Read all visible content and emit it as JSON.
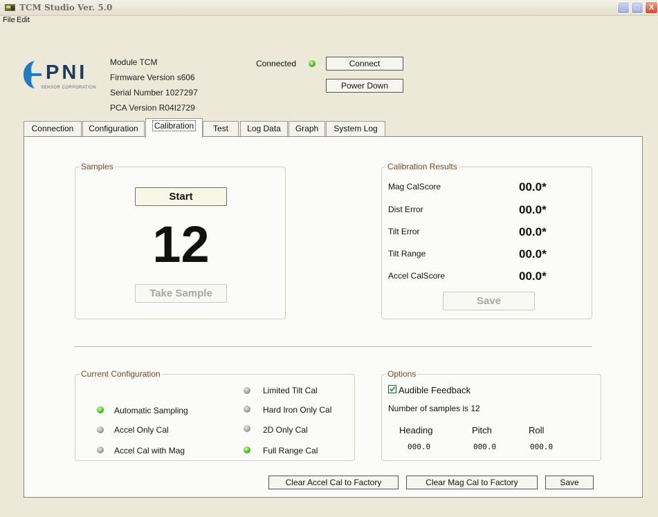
{
  "window": {
    "title": "TCM Studio Ver. 5.0"
  },
  "menu": [
    "File",
    "Edit"
  ],
  "header": {
    "logo_text": "PNI",
    "logo_subtext": "SENSOR CORPORATION",
    "module": "Module TCM",
    "firmware": "Firmware Version s606",
    "serial": "Serial Number 1027297",
    "pca": "PCA Version R04I2729",
    "connected_label": "Connected",
    "connect_label": "Connect",
    "power_down_label": "Power Down"
  },
  "tabs": [
    {
      "label": "Connection",
      "active": false
    },
    {
      "label": "Configuration",
      "active": false
    },
    {
      "label": "Calibration",
      "active": true
    },
    {
      "label": "Test",
      "active": false
    },
    {
      "label": "Log Data",
      "active": false
    },
    {
      "label": "Graph",
      "active": false
    },
    {
      "label": "System Log",
      "active": false
    }
  ],
  "samples": {
    "title": "Samples",
    "start_label": "Start",
    "count": "12",
    "take_sample_label": "Take Sample"
  },
  "results": {
    "title": "Calibration Results",
    "rows": [
      {
        "label": "Mag CalScore",
        "value": "00.0*"
      },
      {
        "label": "Dist Error",
        "value": "00.0*"
      },
      {
        "label": "Tilt Error",
        "value": "00.0*"
      },
      {
        "label": "Tilt Range",
        "value": "00.0*"
      },
      {
        "label": "Accel CalScore",
        "value": "00.0*"
      }
    ],
    "save_label": "Save"
  },
  "config": {
    "title": "Current Configuration",
    "items": [
      {
        "label": "Limited Tilt Cal",
        "status": "gray"
      },
      {
        "label": "Automatic Sampling",
        "status": "green"
      },
      {
        "label": "Hard Iron Only Cal",
        "status": "gray"
      },
      {
        "label": "Accel Only Cal",
        "status": "gray"
      },
      {
        "label": "2D Only Cal",
        "status": "gray"
      },
      {
        "label": "Accel Cal with Mag",
        "status": "gray"
      },
      {
        "label": "Full Range Cal",
        "status": "green"
      }
    ]
  },
  "options": {
    "title": "Options",
    "audible_label": "Audible Feedback",
    "audible_checked": true,
    "samples_text": "Number of samples is 12",
    "heading_label": "Heading",
    "pitch_label": "Pitch",
    "roll_label": "Roll",
    "heading_value": "000.0",
    "pitch_value": "000.0",
    "roll_value": "000.0"
  },
  "footer": {
    "clear_accel_label": "Clear Accel Cal to Factory",
    "clear_mag_label": "Clear Mag Cal to Factory",
    "save_label": "Save"
  },
  "colors": {
    "group_title": "#7a4a1f",
    "led_green": "#46c21c",
    "led_gray": "#9c9c9c"
  }
}
